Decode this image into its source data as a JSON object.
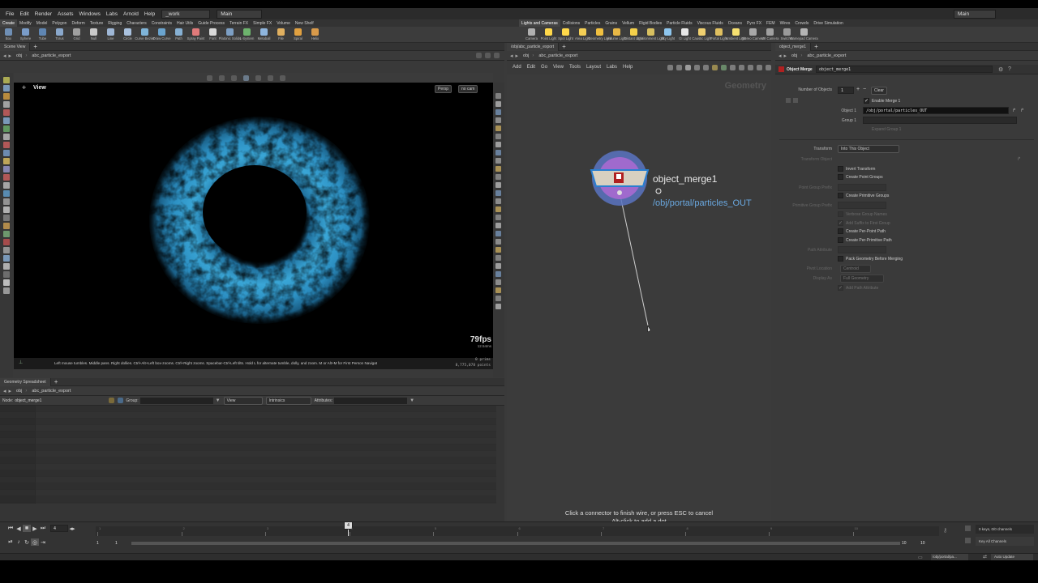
{
  "menubar": {
    "items": [
      "File",
      "Edit",
      "Render",
      "Assets",
      "Windows",
      "Labs",
      "Arnold",
      "Help"
    ],
    "desktop": "_work",
    "layout": "Main",
    "right_desktop": "Main"
  },
  "shelf_tabs_left": [
    "Create",
    "Modify",
    "Model",
    "Polygon",
    "Deform",
    "Texture",
    "Rigging",
    "Characters",
    "Constraints",
    "Hair Utils",
    "Guide Process",
    "Terrain FX",
    "Simple FX",
    "Volume",
    "New Shelf"
  ],
  "shelf_tabs_right": [
    "Lights and Cameras",
    "Collisions",
    "Particles",
    "Grains",
    "Vellum",
    "Rigid Bodies",
    "Particle Fluids",
    "Viscous Fluids",
    "Oceans",
    "Pyro FX",
    "FEM",
    "Wires",
    "Crowds",
    "Drive Simulation"
  ],
  "tools_left": [
    {
      "label": "Box",
      "color": "#6f8fb5"
    },
    {
      "label": "Sphere",
      "color": "#7a9cc8"
    },
    {
      "label": "Tube",
      "color": "#5f86b3"
    },
    {
      "label": "Torus",
      "color": "#8aa8cc"
    },
    {
      "label": "Grid",
      "color": "#a0a0a0"
    },
    {
      "label": "Null",
      "color": "#c9c9c9"
    },
    {
      "label": "Line",
      "color": "#9fb7d6"
    },
    {
      "label": "Circle",
      "color": "#a9c1de"
    },
    {
      "label": "Curve Bezier",
      "color": "#7fb4d8"
    },
    {
      "label": "Draw Curve",
      "color": "#6aa4cf"
    },
    {
      "label": "Path",
      "color": "#86b0d3"
    },
    {
      "label": "Spray Paint",
      "color": "#e07a7a"
    },
    {
      "label": "Font",
      "color": "#d8d8d8"
    },
    {
      "label": "Platonic Solids",
      "color": "#7d9fc4"
    },
    {
      "label": "L-System",
      "color": "#6db36d"
    },
    {
      "label": "Metaball",
      "color": "#8fb6de"
    },
    {
      "label": "File",
      "color": "#e0b060"
    },
    {
      "label": "Spiral",
      "color": "#e0a040"
    },
    {
      "label": "Helix",
      "color": "#d89a4a"
    }
  ],
  "tools_right": [
    {
      "label": "Camera",
      "color": "#b0b0b0"
    },
    {
      "label": "Point Light",
      "color": "#ffd84a"
    },
    {
      "label": "Spot Light",
      "color": "#ffd84a"
    },
    {
      "label": "Area Light",
      "color": "#f4cf55"
    },
    {
      "label": "Geometry Light",
      "color": "#f0c040"
    },
    {
      "label": "Volume Light",
      "color": "#e8b846"
    },
    {
      "label": "Distant Light",
      "color": "#f4d04a"
    },
    {
      "label": "Environment Light",
      "color": "#d8c060"
    },
    {
      "label": "Sky Light",
      "color": "#8ec6ee"
    },
    {
      "label": "GI Light",
      "color": "#e8e8e8"
    },
    {
      "label": "Caustic Light",
      "color": "#f0d070"
    },
    {
      "label": "Portal Light",
      "color": "#e0c060"
    },
    {
      "label": "Ambient Light",
      "color": "#f6e070"
    },
    {
      "label": "Stereo Camera",
      "color": "#a8a8a8"
    },
    {
      "label": "VR Camera",
      "color": "#a0a0a0"
    },
    {
      "label": "Switcher",
      "color": "#9a9a9a"
    },
    {
      "label": "Gamepad Camera",
      "color": "#b4b4b4"
    }
  ],
  "scene_view": {
    "tab": "Scene View",
    "path_root": "obj",
    "path_node": "abc_particle_export",
    "view_label": "View",
    "persp": "Persp",
    "camera": "no cam",
    "fps": "79fps",
    "ms": "12.54ms",
    "prims": "0  prims",
    "points": "8,775,078 points",
    "hint": "Left mouse tumbles. Middle pans. Right dollies. Ctrl+Alt+Left box-zooms. Ctrl+Right zooms. Spacebar-Ctrl-Left tilts. Hold L for alternate tumble, dolly, and zoom. M or Alt+M for First Person Navigat"
  },
  "spreadsheet": {
    "tab": "Geometry Spreadsheet",
    "path_root": "obj",
    "path_node": "abc_particle_export",
    "node_label": "Node:",
    "node_value": "object_merge1",
    "group_label": "Group:",
    "view_label": "View",
    "intrinsics": "Intrinsics",
    "attributes_label": "Attributes:"
  },
  "network": {
    "tab": "/obj/abc_particle_export",
    "path_root": "obj",
    "path_node": "abc_particle_export",
    "menu": [
      "Add",
      "Edit",
      "Go",
      "View",
      "Tools",
      "Layout",
      "Labs",
      "Help"
    ],
    "context": "Geometry",
    "node_name": "object_merge1",
    "node_path": "/obj/portal/particles_OUT",
    "status_line1": "Click a connector to finish wire, or press ESC to cancel",
    "status_line2": "Alt-click to add a dot"
  },
  "params": {
    "tab": "object_merge1",
    "path_root": "obj",
    "path_node": "abc_particle_export",
    "node_type": "Object Merge",
    "node_name": "object_merge1",
    "num_objects_label": "Number of Objects",
    "num_objects": "1",
    "clear": "Clear",
    "enable_merge": "Enable Merge 1",
    "object1_label": "Object 1",
    "object1_value": "/obj/portal/particles_OUT",
    "group1_label": "Group 1",
    "expand_group": "Expand Group 1",
    "transform_label": "Transform",
    "transform_value": "Into This Object",
    "transform_object": "Transform Object",
    "invert_transform": "Invert Transform",
    "create_point_groups": "Create Point Groups",
    "point_group_prefix": "Point Group Prefix",
    "create_primitive_groups": "Create Primitive Groups",
    "primitive_group_prefix": "Primitive Group Prefix",
    "verbose_group_names": "Verbose Group Names",
    "add_suffix": "Add Suffix to First Group",
    "create_per_point_path": "Create Per-Point Path",
    "create_per_primitive_path": "Create Per-Primitive Path",
    "path_attribute": "Path Attribute",
    "pack_geometry": "Pack Geometry Before Merging",
    "pivot_location": "Pivot Location",
    "pivot_value": "Centroid",
    "display_as": "Display As",
    "display_value": "Full Geometry",
    "add_path_attribute": "Add Path Attribute"
  },
  "timeline": {
    "frame": "4",
    "start": "1",
    "start2": "1",
    "end": "10",
    "end2": "10",
    "ticks": [
      "1",
      "2",
      "3",
      "4",
      "5",
      "6",
      "7",
      "8",
      "9",
      "10"
    ],
    "keys_info": "0 keys, 0/0 channels",
    "key_all": "Key All Channels",
    "path": "/obj/portal/pa...",
    "auto_update": "Auto Update"
  }
}
